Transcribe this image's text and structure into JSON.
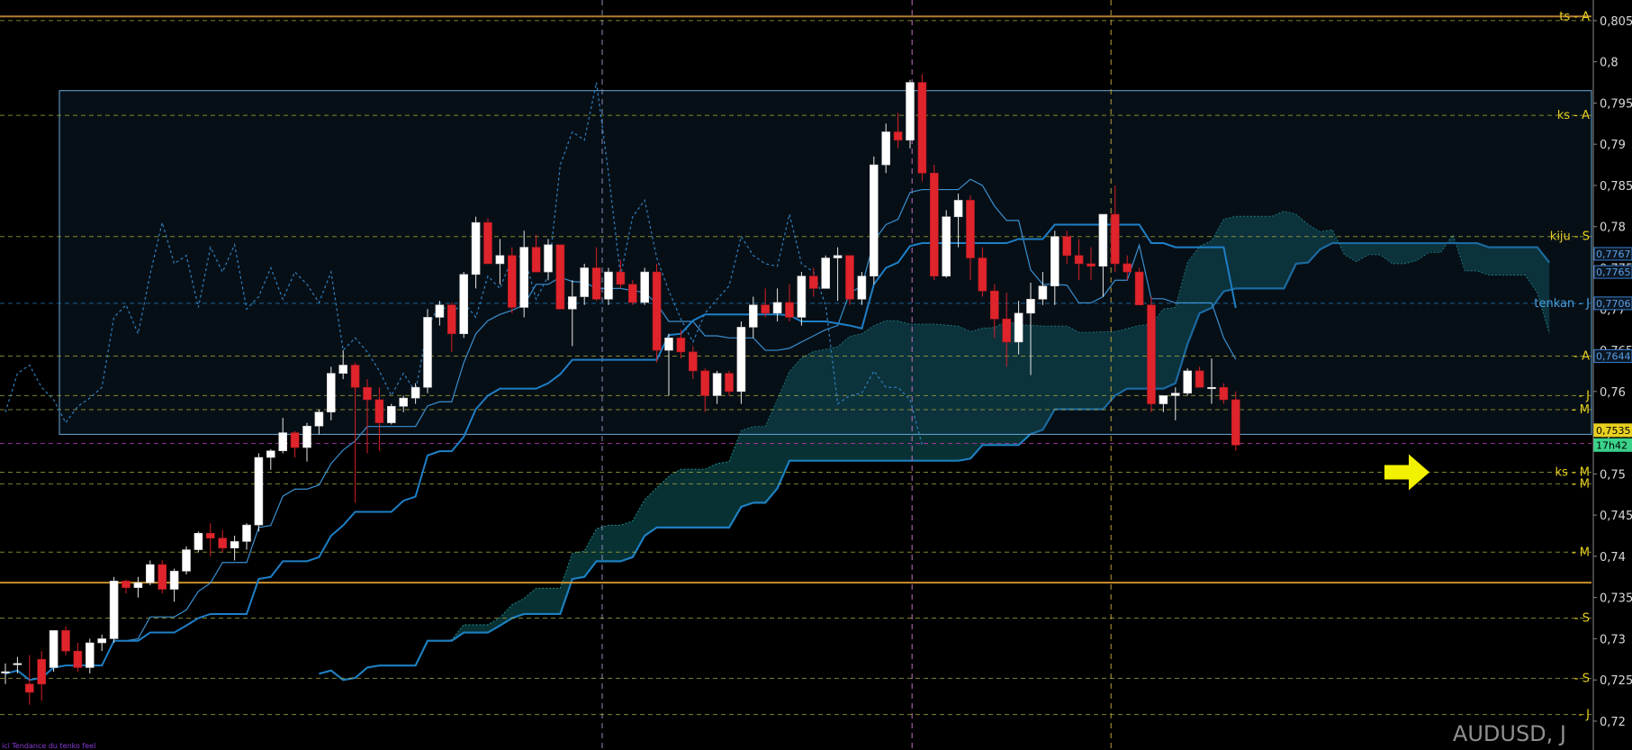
{
  "chart_data": {
    "type": "candlestick",
    "symbol": "AUDUSD, J",
    "ylim": [
      0.7165,
      0.8075
    ],
    "y_ticks": [
      "0,805",
      "0,8",
      "0,795",
      "0,79",
      "0,785",
      "0,78",
      "0,775",
      "0,77",
      "0,765",
      "0,76",
      "0,755",
      "0,75",
      "0,745",
      "0,74",
      "0,735",
      "0,73",
      "0,725",
      "0,72"
    ],
    "y_tick_values": [
      0.805,
      0.8,
      0.795,
      0.79,
      0.785,
      0.78,
      0.775,
      0.77,
      0.765,
      0.76,
      0.755,
      0.75,
      0.745,
      0.74,
      0.735,
      0.73,
      0.725,
      0.72
    ],
    "candles_ohlc": [
      [
        0.726,
        0.727,
        0.7245,
        0.726
      ],
      [
        0.727,
        0.7278,
        0.7258,
        0.727
      ],
      [
        0.7245,
        0.728,
        0.722,
        0.7235
      ],
      [
        0.7275,
        0.7285,
        0.7225,
        0.7245
      ],
      [
        0.7265,
        0.731,
        0.726,
        0.731
      ],
      [
        0.731,
        0.7315,
        0.728,
        0.7285
      ],
      [
        0.7285,
        0.7295,
        0.726,
        0.7265
      ],
      [
        0.7265,
        0.73,
        0.7258,
        0.7295
      ],
      [
        0.7295,
        0.7305,
        0.7285,
        0.73
      ],
      [
        0.73,
        0.7375,
        0.7295,
        0.737
      ],
      [
        0.737,
        0.7372,
        0.7355,
        0.7362
      ],
      [
        0.7362,
        0.7375,
        0.735,
        0.7368
      ],
      [
        0.7368,
        0.7395,
        0.7365,
        0.739
      ],
      [
        0.739,
        0.7395,
        0.7355,
        0.736
      ],
      [
        0.736,
        0.7385,
        0.7345,
        0.7382
      ],
      [
        0.7382,
        0.7412,
        0.7378,
        0.7408
      ],
      [
        0.7408,
        0.743,
        0.7405,
        0.7428
      ],
      [
        0.7428,
        0.744,
        0.74,
        0.7422
      ],
      [
        0.7422,
        0.7432,
        0.7405,
        0.741
      ],
      [
        0.741,
        0.7425,
        0.7395,
        0.7418
      ],
      [
        0.7418,
        0.744,
        0.7408,
        0.7438
      ],
      [
        0.7438,
        0.7525,
        0.743,
        0.752
      ],
      [
        0.752,
        0.753,
        0.7505,
        0.7528
      ],
      [
        0.7528,
        0.7568,
        0.7525,
        0.755
      ],
      [
        0.755,
        0.7552,
        0.752,
        0.7532
      ],
      [
        0.7532,
        0.7562,
        0.7515,
        0.7558
      ],
      [
        0.7558,
        0.7578,
        0.7548,
        0.7575
      ],
      [
        0.7575,
        0.763,
        0.7565,
        0.7622
      ],
      [
        0.7622,
        0.765,
        0.7615,
        0.7632
      ],
      [
        0.7632,
        0.7635,
        0.7465,
        0.7605
      ],
      [
        0.7605,
        0.7615,
        0.7525,
        0.759
      ],
      [
        0.759,
        0.7605,
        0.7528,
        0.7562
      ],
      [
        0.7562,
        0.7585,
        0.756,
        0.7582
      ],
      [
        0.7582,
        0.7595,
        0.7575,
        0.7592
      ],
      [
        0.7592,
        0.761,
        0.7585,
        0.7605
      ],
      [
        0.7605,
        0.77,
        0.7598,
        0.769
      ],
      [
        0.769,
        0.771,
        0.768,
        0.7705
      ],
      [
        0.7705,
        0.7708,
        0.7648,
        0.767
      ],
      [
        0.767,
        0.7745,
        0.7665,
        0.7742
      ],
      [
        0.7742,
        0.7812,
        0.7725,
        0.7805
      ],
      [
        0.7805,
        0.781,
        0.7755,
        0.7755
      ],
      [
        0.7755,
        0.7785,
        0.773,
        0.7765
      ],
      [
        0.7765,
        0.7775,
        0.7695,
        0.7702
      ],
      [
        0.7702,
        0.7795,
        0.769,
        0.7775
      ],
      [
        0.7775,
        0.779,
        0.7745,
        0.7745
      ],
      [
        0.7745,
        0.7785,
        0.7735,
        0.7778
      ],
      [
        0.7778,
        0.7778,
        0.77,
        0.77
      ],
      [
        0.77,
        0.7735,
        0.7655,
        0.7715
      ],
      [
        0.7715,
        0.7755,
        0.7705,
        0.775
      ],
      [
        0.775,
        0.7775,
        0.771,
        0.7712
      ],
      [
        0.7712,
        0.775,
        0.7705,
        0.7745
      ],
      [
        0.7745,
        0.776,
        0.7725,
        0.773
      ],
      [
        0.773,
        0.7735,
        0.7705,
        0.7708
      ],
      [
        0.7708,
        0.775,
        0.7705,
        0.7745
      ],
      [
        0.7745,
        0.7755,
        0.7635,
        0.765
      ],
      [
        0.765,
        0.767,
        0.7595,
        0.7665
      ],
      [
        0.7665,
        0.7675,
        0.764,
        0.7648
      ],
      [
        0.7648,
        0.7655,
        0.7615,
        0.7625
      ],
      [
        0.7625,
        0.7628,
        0.7575,
        0.7595
      ],
      [
        0.7595,
        0.7625,
        0.7585,
        0.7622
      ],
      [
        0.7622,
        0.7625,
        0.7595,
        0.76
      ],
      [
        0.76,
        0.7685,
        0.7585,
        0.7678
      ],
      [
        0.7678,
        0.7715,
        0.7665,
        0.7705
      ],
      [
        0.7705,
        0.7725,
        0.769,
        0.7695
      ],
      [
        0.7695,
        0.7725,
        0.7685,
        0.7708
      ],
      [
        0.7708,
        0.773,
        0.7685,
        0.769
      ],
      [
        0.769,
        0.7745,
        0.768,
        0.774
      ],
      [
        0.774,
        0.775,
        0.7715,
        0.7725
      ],
      [
        0.7725,
        0.7765,
        0.7725,
        0.7762
      ],
      [
        0.7762,
        0.7775,
        0.771,
        0.7765
      ],
      [
        0.7765,
        0.7765,
        0.7705,
        0.7712
      ],
      [
        0.7712,
        0.7745,
        0.7705,
        0.774
      ],
      [
        0.774,
        0.7885,
        0.773,
        0.7875
      ],
      [
        0.7875,
        0.7925,
        0.7865,
        0.7915
      ],
      [
        0.7915,
        0.7938,
        0.7895,
        0.7905
      ],
      [
        0.7905,
        0.7978,
        0.7895,
        0.7975
      ],
      [
        0.7975,
        0.7985,
        0.7855,
        0.7865
      ],
      [
        0.7865,
        0.7875,
        0.7735,
        0.774
      ],
      [
        0.774,
        0.782,
        0.7738,
        0.7812
      ],
      [
        0.7812,
        0.784,
        0.7775,
        0.7832
      ],
      [
        0.7832,
        0.7838,
        0.7735,
        0.7762
      ],
      [
        0.7762,
        0.7775,
        0.7715,
        0.7722
      ],
      [
        0.7722,
        0.773,
        0.7665,
        0.7688
      ],
      [
        0.7688,
        0.772,
        0.763,
        0.766
      ],
      [
        0.766,
        0.771,
        0.7645,
        0.7695
      ],
      [
        0.7695,
        0.7732,
        0.762,
        0.7712
      ],
      [
        0.7712,
        0.7745,
        0.7705,
        0.7728
      ],
      [
        0.7728,
        0.7795,
        0.7705,
        0.7788
      ],
      [
        0.7788,
        0.7795,
        0.7755,
        0.7765
      ],
      [
        0.7765,
        0.7785,
        0.7735,
        0.7755
      ],
      [
        0.7755,
        0.7775,
        0.7735,
        0.7752
      ],
      [
        0.7752,
        0.781,
        0.7715,
        0.7815
      ],
      [
        0.7815,
        0.785,
        0.7745,
        0.7755
      ],
      [
        0.7755,
        0.7765,
        0.7735,
        0.7745
      ],
      [
        0.7745,
        0.775,
        0.7705,
        0.7705
      ],
      [
        0.7705,
        0.7715,
        0.7575,
        0.7585
      ],
      [
        0.7585,
        0.7595,
        0.7575,
        0.7595
      ],
      [
        0.7595,
        0.7605,
        0.7565,
        0.7598
      ],
      [
        0.7598,
        0.7628,
        0.7595,
        0.7625
      ],
      [
        0.7625,
        0.763,
        0.7605,
        0.7605
      ],
      [
        0.7605,
        0.764,
        0.7585,
        0.7605
      ],
      [
        0.7605,
        0.761,
        0.7585,
        0.759
      ],
      [
        0.759,
        0.76,
        0.7528,
        0.7535
      ]
    ],
    "levels": [
      {
        "name": "ts - A",
        "value": 0.8055,
        "color": "#c58c3a",
        "style": "solid"
      },
      {
        "name": "",
        "value": 0.805,
        "color": "#b8b83a",
        "style": "dashed"
      },
      {
        "name": "ks - A",
        "value": 0.7935,
        "color": "#b8b83a",
        "style": "dashed"
      },
      {
        "name": "kiju - S",
        "value": 0.7788,
        "color": "#b8b83a",
        "style": "dashed"
      },
      {
        "name": "tenkan - J",
        "value": 0.7707,
        "color": "#1d84c8",
        "style": "dashed"
      },
      {
        "name": "A",
        "value": 0.7643,
        "color": "#b8b83a",
        "style": "dashed"
      },
      {
        "name": "J",
        "value": 0.7595,
        "color": "#b8b83a",
        "style": "dashed"
      },
      {
        "name": "M",
        "value": 0.7578,
        "color": "#b8b83a",
        "style": "dashed"
      },
      {
        "name": "ks - M",
        "value": 0.7502,
        "color": "#b8b83a",
        "style": "dashed"
      },
      {
        "name": "M",
        "value": 0.7488,
        "color": "#b8b83a",
        "style": "dashed"
      },
      {
        "name": "M",
        "value": 0.7405,
        "color": "#b8b83a",
        "style": "dashed"
      },
      {
        "name": "",
        "value": 0.7368,
        "color": "#e0a030",
        "style": "solid"
      },
      {
        "name": "S",
        "value": 0.7325,
        "color": "#b8b83a",
        "style": "dashed"
      },
      {
        "name": "S",
        "value": 0.7252,
        "color": "#b8b83a",
        "style": "dashed"
      },
      {
        "name": "J",
        "value": 0.7208,
        "color": "#b8b83a",
        "style": "dashed"
      },
      {
        "name": "",
        "value": 0.7537,
        "color": "#d23ad2",
        "style": "dashed"
      }
    ],
    "price_tags": [
      {
        "value": 0.7767,
        "text": "0,7767",
        "color": "#3a7fd0"
      },
      {
        "value": 0.7745,
        "text": "0,7765",
        "color": "#3a7fd0"
      },
      {
        "value": 0.7707,
        "text": "0,7706",
        "color": "#3a7fd0"
      },
      {
        "value": 0.7643,
        "text": "0,7644",
        "color": "#3a7fd0"
      },
      {
        "value": 0.7553,
        "text": "0,7535",
        "color": "#e8d020"
      },
      {
        "value": 0.7535,
        "text": "17h42",
        "color": "#3ad28a"
      }
    ],
    "box": {
      "x_start": 0,
      "x_end": 0.7552,
      "y_top": 0.7965,
      "y_bottom": 0.7548
    },
    "vertical_markers": [
      20,
      33,
      48
    ],
    "arrow": {
      "value": 0.7502
    }
  },
  "legend_corner": "ici Tendance du tenko feel"
}
